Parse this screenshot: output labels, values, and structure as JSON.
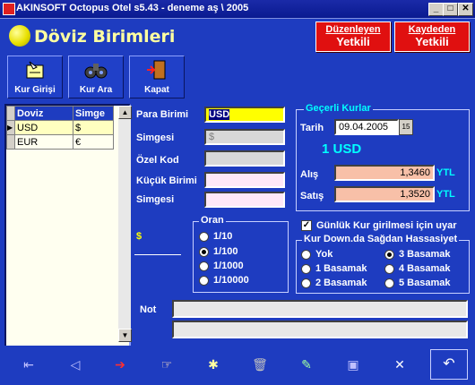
{
  "window": {
    "title": "AKINSOFT Octopus Otel s5.43  -  deneme aş \\ 2005",
    "min": "_",
    "max": "□",
    "close": "✕"
  },
  "header": {
    "title": "Döviz Birimleri",
    "btn_duzenleyen": {
      "top": "Düzenleyen",
      "bottom": "Yetkili"
    },
    "btn_kaydeden": {
      "top": "Kaydeden",
      "bottom": "Yetkili"
    }
  },
  "toolbar": [
    {
      "label": "Kur Girişi",
      "icon": "rate-entry-icon"
    },
    {
      "label": "Kur Ara",
      "icon": "binoculars-icon"
    },
    {
      "label": "Kapat",
      "icon": "exit-door-icon"
    }
  ],
  "grid": {
    "headers": [
      "Doviz",
      "Simge"
    ],
    "rows": [
      {
        "doviz": "USD",
        "simge": "$"
      },
      {
        "doviz": "EUR",
        "simge": "€"
      }
    ]
  },
  "form": {
    "para_birimi_label": "Para Birimi",
    "para_birimi_value": "USD",
    "simgesi_label": "Simgesi",
    "simgesi_value": "$",
    "ozel_kod_label": "Özel Kod",
    "ozel_kod_value": "",
    "kucuk_birimi_label": "Küçük Birimi",
    "kucuk_simgesi_label": "Simgesi",
    "preview_symbol": "$"
  },
  "oran": {
    "legend": "Oran",
    "options": [
      "1/10",
      "1/100",
      "1/1000",
      "1/10000"
    ],
    "selected": "1/100"
  },
  "gecerli": {
    "legend": "Geçerli Kurlar",
    "tarih_label": "Tarih",
    "tarih_value": "09.04.2005",
    "calendar_text": "15",
    "unit_display": "1 USD",
    "alis_label": "Alış",
    "alis_value": "1,3460",
    "satis_label": "Satış",
    "satis_value": "1,3520",
    "currency": "YTL"
  },
  "gunluk": {
    "label": "Günlük Kur girilmesi için uyar",
    "checked": true,
    "check_mark": "✓"
  },
  "hassasiyet": {
    "legend": "Kur Down.da Sağdan Hassasiyet",
    "options": [
      "Yok",
      "3 Basamak",
      "1 Basamak",
      "4 Basamak",
      "2 Basamak",
      "5 Basamak"
    ],
    "selected": "3 Basamak"
  },
  "not": {
    "label": "Not",
    "value": ""
  },
  "scroll": {
    "up": "▲",
    "down": "▼"
  },
  "bottom_icons": [
    "first-record-icon",
    "previous-record-icon",
    "next-record-icon",
    "last-record-icon",
    "new-record-icon",
    "delete-icon",
    "edit-icon",
    "save-icon",
    "cancel-icon",
    "refresh-icon"
  ],
  "colors": {
    "bg": "#1e3cc0",
    "red_button": "#e01010",
    "field_yellow": "#ffff00",
    "field_pink": "#f8c0a8",
    "field_lilac": "#ffe8f8",
    "accent_cyan": "#00ffff"
  }
}
